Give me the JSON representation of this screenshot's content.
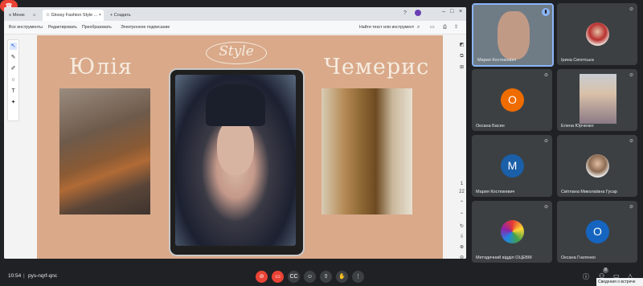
{
  "browser": {
    "tabs": [
      {
        "label": "Меню"
      },
      {
        "label": ""
      },
      {
        "label": "Glossy Fashion Style ..."
      },
      {
        "label": "+ Создать"
      }
    ],
    "toolbar": {
      "all_tools": "Все инструменты",
      "edit": "Редактировать",
      "convert": "Преобразовать",
      "sign": "Электронное подписание",
      "find": "Найти текст или инструмент"
    }
  },
  "slide": {
    "name_left": "Юлія",
    "name_right": "Чемерис",
    "style_word": "Style"
  },
  "right_panel": {
    "page_number": "1",
    "page_total": "22"
  },
  "participants": [
    {
      "name": "Мария Костюкевич",
      "mic_off": false,
      "avatar_type": "video"
    },
    {
      "name": "Ірина Сигетська",
      "mic_off": true,
      "avatar_type": "photo",
      "color": "#b7302f"
    },
    {
      "name": "Оксана Басин",
      "mic_off": true,
      "avatar_type": "letter",
      "letter": "O",
      "color": "#ef6c00"
    },
    {
      "name": "Елена Юрченко",
      "mic_off": true,
      "avatar_type": "video"
    },
    {
      "name": "Мария Костюкевич",
      "mic_off": true,
      "avatar_type": "letter",
      "letter": "M",
      "color": "#1a5fa8"
    },
    {
      "name": "Світлана Миколаївна Гусар",
      "mic_off": true,
      "avatar_type": "photo",
      "color": "#8c6b52"
    },
    {
      "name": "Методичний відділ ОЦЕВМ",
      "mic_off": true,
      "avatar_type": "photo",
      "color": "#1e88e5"
    },
    {
      "name": "Оксана Гнатенко",
      "mic_off": true,
      "avatar_type": "letter",
      "letter": "O",
      "color": "#1565c0"
    }
  ],
  "meeting": {
    "time": "10:54",
    "separator": "|",
    "code": "pys-nqrf-qnc",
    "participant_count": "8",
    "tooltip": "Сведения о встрече"
  },
  "colors": {
    "slide_bg": "#d9a98a",
    "end_call": "#ea4335",
    "tile_bg": "#3c4043",
    "page_bg": "#202124"
  }
}
